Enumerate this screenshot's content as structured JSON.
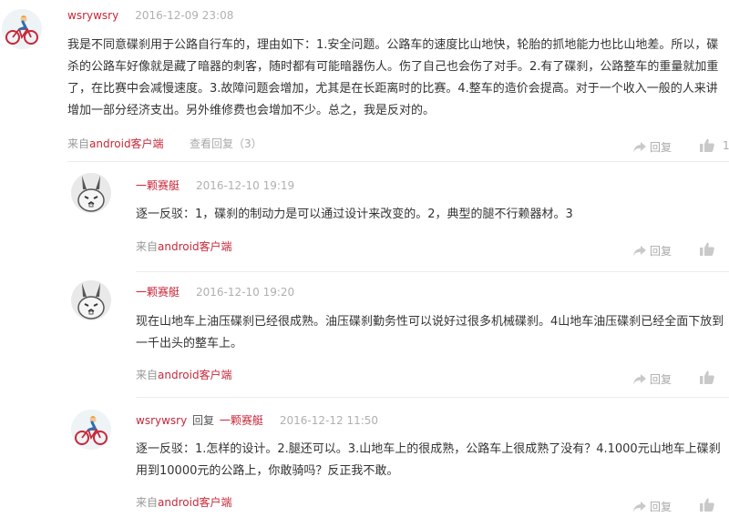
{
  "comments": [
    {
      "user": "wsrywsry",
      "time": "2016-12-09 23:08",
      "text": "我是不同意碟刹用于公路自行车的，理由如下：1.安全问题。公路车的速度比山地快，轮胎的抓地能力也比山地差。所以，碟杀的公路车好像就是藏了暗器的刺客，随时都有可能暗器伤人。伤了自己也会伤了对手。2.有了碟刹，公路整车的重量就加重了，在比赛中会减慢速度。3.故障问题会增加，尤其是在长距离时的比赛。4.整车的造价会提高。对于一个收入一般的人来讲增加一部分经济支出。另外维修费也会增加不少。总之，我是反对的。",
      "source_prefix": "来自",
      "source_app": "android客户端",
      "view_replies": "查看回复（3）",
      "reply_label": "回复",
      "like_count": "1"
    },
    {
      "user": "一颗赛艇",
      "time": "2016-12-10 19:19",
      "text": "逐一反驳：1，碟刹的制动力是可以通过设计来改变的。2，典型的腿不行赖器材。3",
      "source_prefix": "来自",
      "source_app": "android客户端",
      "reply_label": "回复"
    },
    {
      "user": "一颗赛艇",
      "time": "2016-12-10 19:20",
      "text": "现在山地车上油压碟刹已经很成熟。油压碟刹勤务性可以说好过很多机械碟刹。4山地车油压碟刹已经全面下放到一千出头的整车上。",
      "source_prefix": "来自",
      "source_app": "android客户端",
      "reply_label": "回复"
    },
    {
      "user": "wsrywsry",
      "reply_word": "回复",
      "reply_to": "一颗赛艇",
      "time": "2016-12-12 11:50",
      "text": "逐一反驳：1.怎样的设计。2.腿还可以。3.山地车上的很成熟，公路车上很成熟了没有？4.1000元山地车上碟刹用到10000元的公路上，你敢骑吗？反正我不敢。",
      "source_prefix": "来自",
      "source_app": "android客户端",
      "reply_label": "回复"
    }
  ],
  "icons": {
    "reply": "share-arrow-icon",
    "like": "thumbs-up-icon",
    "avatar_cyclist": "cyclist-avatar",
    "avatar_bunny": "bunny-avatar"
  },
  "colors": {
    "username": "#c8283a",
    "muted": "#aaaaaa",
    "text": "#333333"
  }
}
